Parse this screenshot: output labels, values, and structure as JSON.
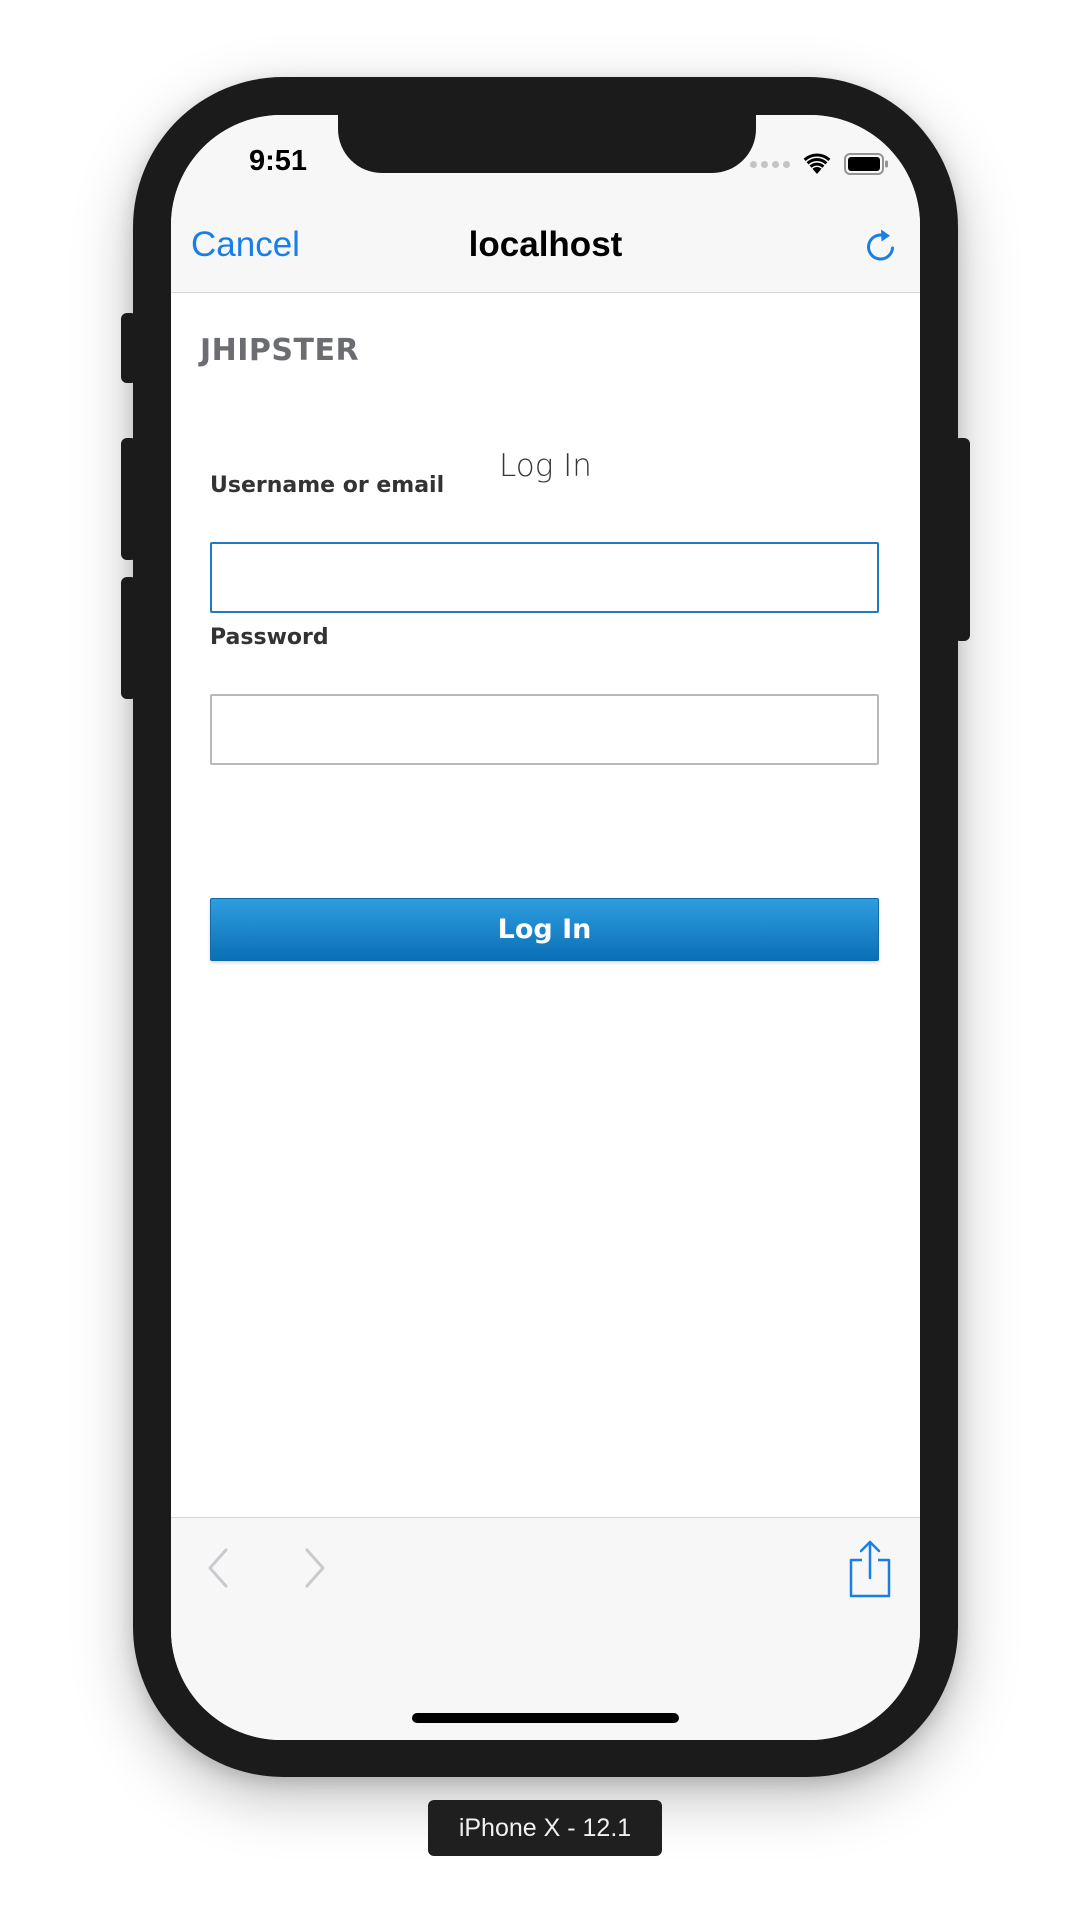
{
  "status_bar": {
    "time": "9:51"
  },
  "nav_bar": {
    "cancel_label": "Cancel",
    "title": "localhost"
  },
  "page": {
    "brand": "JHIPSTER",
    "heading": "Log In",
    "username": {
      "label": "Username or email",
      "value": "",
      "placeholder": ""
    },
    "password": {
      "label": "Password",
      "value": "",
      "placeholder": ""
    },
    "submit_label": "Log In"
  },
  "toolbar": {
    "back_enabled": false,
    "forward_enabled": false
  },
  "device_label": "iPhone X - 12.1",
  "colors": {
    "ios_accent": "#1a7ee8",
    "button_gradient_top": "#2e9ee0",
    "button_gradient_bottom": "#0b6fb6",
    "focus_border": "#1f7ac4",
    "bezel": "#1b1b1b"
  }
}
